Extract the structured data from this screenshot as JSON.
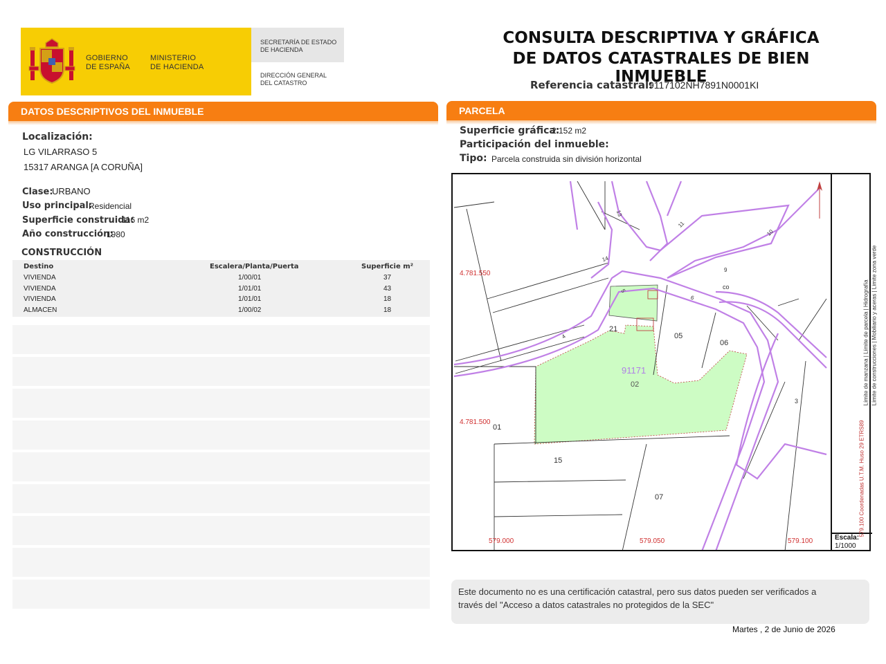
{
  "header": {
    "logo_gov_line1": "GOBIERNO",
    "logo_gov_line2": "DE ESPAÑA",
    "logo_min_line1": "MINISTERIO",
    "logo_min_line2": "DE HACIENDA",
    "sec_line1": "SECRETARÍA DE ESTADO",
    "sec_line2": "DE HACIENDA",
    "dir_line1": "DIRECCIÓN GENERAL",
    "dir_line2": "DEL CATASTRO",
    "title_line1": "CONSULTA DESCRIPTIVA Y GRÁFICA",
    "title_line2": "DE DATOS CATASTRALES DE BIEN INMUEBLE",
    "ref_label": "Referencia catastral:",
    "ref_value": "9117102NH7891N0001KI"
  },
  "left": {
    "bar_title": "DATOS DESCRIPTIVOS DEL INMUEBLE",
    "localizacion_label": "Localización:",
    "address_line1": "LG VILARRASO 5",
    "address_line2": "15317 ARANGA [A CORUÑA]",
    "clase_label": "Clase:",
    "clase_value": "URBANO",
    "uso_label": "Uso principal:",
    "uso_value": "Residencial",
    "superficie_label": "Superficie construida:",
    "superficie_value": "116 m2",
    "anio_label": "Año construcción:",
    "anio_value": "1980",
    "construccion_title": "CONSTRUCCIÓN",
    "table": {
      "headers": [
        "Destino",
        "Escalera/Planta/Puerta",
        "Superficie m²"
      ],
      "rows": [
        [
          "VIVIENDA",
          "1/00/01",
          "37"
        ],
        [
          "VIVIENDA",
          "1/01/01",
          "43"
        ],
        [
          "VIVIENDA",
          "1/01/01",
          "18"
        ],
        [
          "ALMACEN",
          "1/00/02",
          "18"
        ]
      ]
    }
  },
  "right": {
    "bar_title": "PARCELA",
    "sup_grafica_label": "Superficie gráfica:",
    "sup_grafica_value": "2.152 m2",
    "participacion_label": "Participación del inmueble:",
    "tipo_label": "Tipo:",
    "tipo_value": "Parcela construida sin división horizontal"
  },
  "map": {
    "coord_y1": "4.781.550",
    "coord_y2": "4.781.500",
    "coord_x1": "579.000",
    "coord_x2": "579.050",
    "coord_x3": "579.100",
    "parcel_id": "91171",
    "labels": [
      "02",
      "21",
      "05",
      "06",
      "01",
      "15",
      "07",
      "co",
      "3",
      "4",
      "5",
      "6",
      "9",
      "10",
      "11",
      "13",
      "14"
    ],
    "legend": {
      "limite_manzana": "Límite de manzana",
      "limite_parcela": "Límite de parcela",
      "hidrografia": "Hidrografía",
      "limite_construcciones": "Límite de construcciones",
      "mobiliario": "Mobiliario y aceras",
      "zona_verde": "Límite zona verde",
      "coords_note": "579.100 Coordenadas U.T.M. Huso 29 ETRS89"
    },
    "scale_label": "Escala:",
    "scale_value": "1/1000",
    "colors": {
      "manzana": "#c080e6",
      "parcela_fill": "#cdfcc4",
      "coords": "#d03030"
    }
  },
  "footer": {
    "note_line1": "Este documento no es una certificación catastral, pero sus datos pueden ser verificados a",
    "note_line2": "través del \"Acceso a datos catastrales no protegidos de la SEC\"",
    "date": "Martes , 2 de Junio de 2026"
  }
}
